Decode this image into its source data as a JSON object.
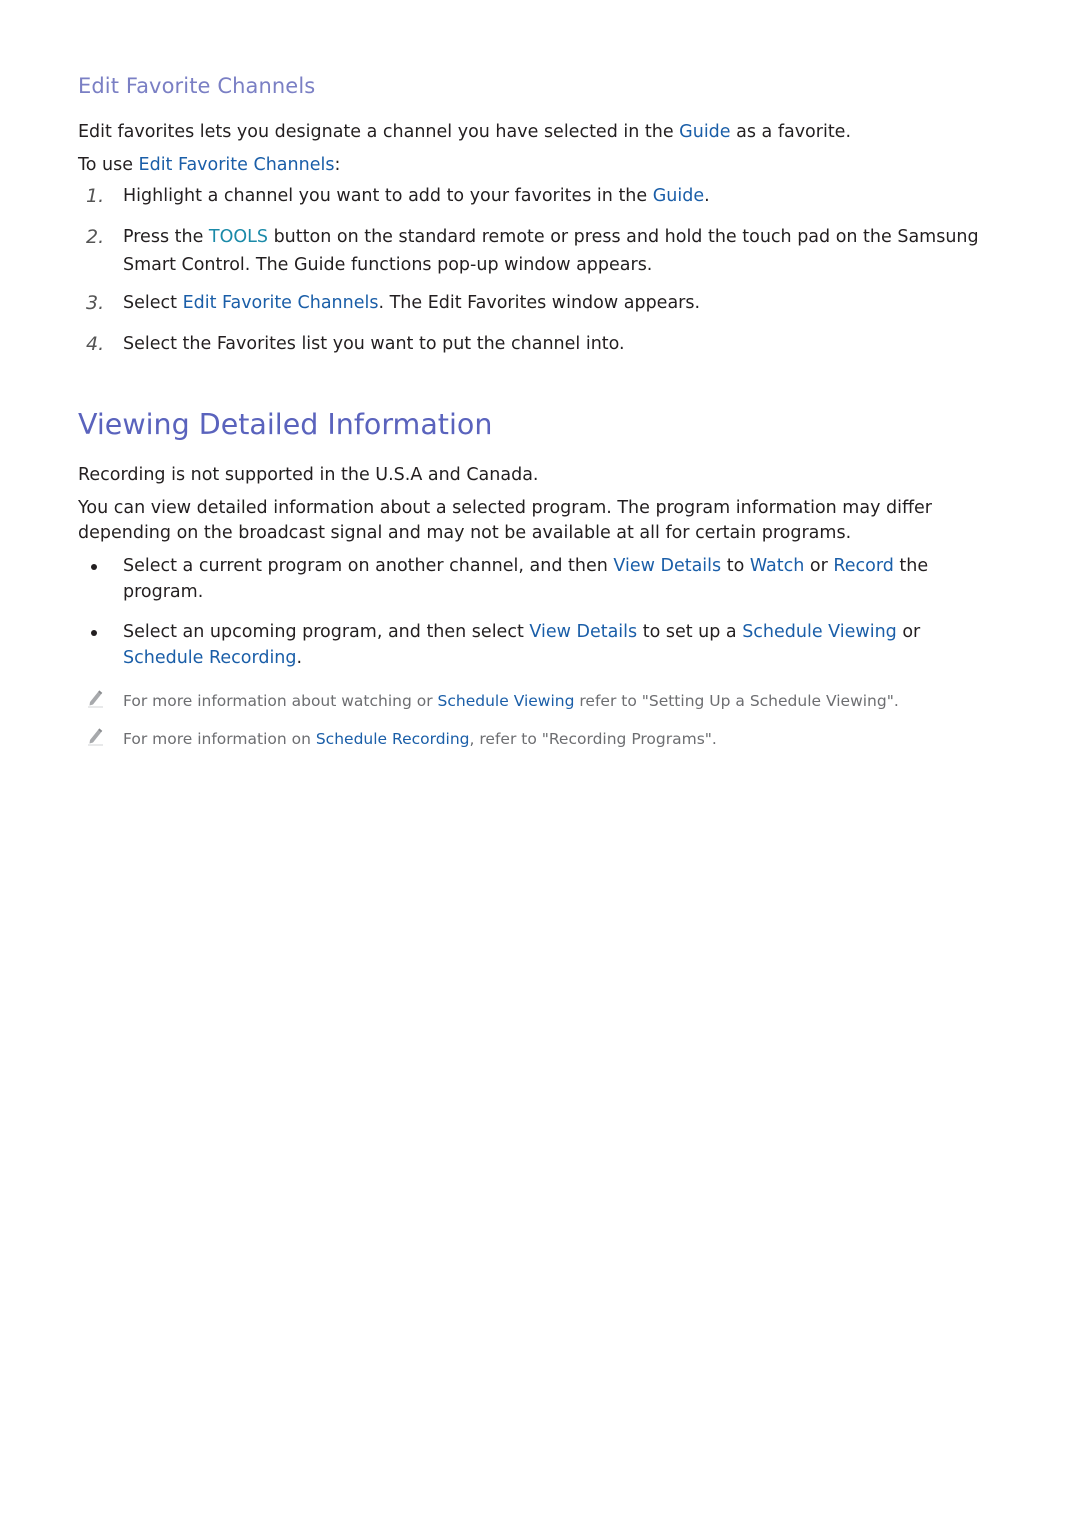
{
  "section_edit": {
    "heading": "Edit Favorite Channels",
    "intro": {
      "pre": "Edit favorites lets you designate a channel you have selected in the ",
      "link": "Guide",
      "post": " as a favorite."
    },
    "to_use": {
      "pre": "To use ",
      "link": "Edit Favorite Channels",
      "post": ":"
    },
    "steps": [
      {
        "num": "1.",
        "pre": "Highlight a channel you want to add to your favorites in the ",
        "link": "Guide",
        "post": "."
      },
      {
        "num": "2.",
        "pre": "Press the ",
        "link": "TOOLS",
        "post": " button on the standard remote or press and hold the touch pad on the Samsung",
        "line2": "Smart Control. The Guide functions pop-up window appears."
      },
      {
        "num": "3.",
        "pre": "Select ",
        "link": "Edit Favorite Channels",
        "post": ". The Edit Favorites window appears."
      },
      {
        "num": "4.",
        "pre": "Select the Favorites list you want to put the channel into.",
        "link": "",
        "post": ""
      }
    ]
  },
  "section_view": {
    "heading": "Viewing Detailed Information",
    "note_recording": "Recording is not supported in the U.S.A and Canada.",
    "para": {
      "line1": "You can view detailed information about a selected program. The program information may differ",
      "line2": "depending on the broadcast signal and may not be available at all for certain programs."
    },
    "bullets": [
      {
        "t1": "Select a current program on another channel, and then ",
        "l1": "View Details",
        "t2": " to ",
        "l2": "Watch",
        "t3": " or ",
        "l3": "Record",
        "t4": " the",
        "line2": "program."
      },
      {
        "t1": "Select an upcoming program, and then select ",
        "l1": "View Details",
        "t2": " to set up a ",
        "l2": "Schedule Viewing",
        "t3": " or",
        "l3": "Schedule Recording",
        "t4": "."
      }
    ],
    "notes": [
      {
        "icon": "pencil-icon",
        "pre": "For more information about watching or ",
        "link": "Schedule Viewing",
        "post": " refer to \"Setting Up a Schedule Viewing\"."
      },
      {
        "icon": "pencil-icon",
        "pre": "For more information on ",
        "link": "Schedule Recording",
        "post": ", refer to \"Recording Programs\"."
      }
    ]
  },
  "colors": {
    "heading_small": "#7a7fc4",
    "heading_large": "#5a63bd",
    "link": "#1a5ea8",
    "tools_link": "#1a8aa8",
    "body_text": "#231f20",
    "note_text": "#6d6e71"
  }
}
